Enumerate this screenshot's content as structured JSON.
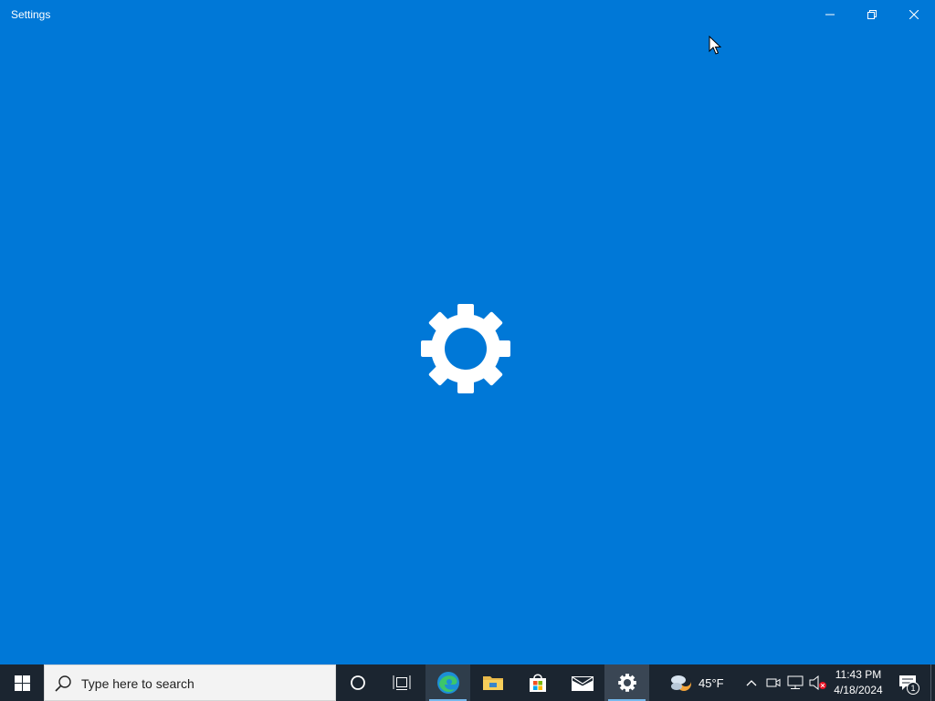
{
  "window": {
    "title": "Settings",
    "background_color": "#0078d7",
    "controls": {
      "minimize_icon": "minimize-icon",
      "maximize_icon": "restore-icon",
      "close_icon": "close-icon"
    },
    "splash_icon": "gear-icon"
  },
  "taskbar": {
    "start_icon": "windows-logo-icon",
    "search": {
      "placeholder": "Type here to search",
      "icon": "search-icon"
    },
    "cortana_icon": "cortana-icon",
    "task_view_icon": "task-view-icon",
    "pinned_apps": [
      {
        "name": "Microsoft Edge",
        "icon": "edge-icon",
        "running": true
      },
      {
        "name": "File Explorer",
        "icon": "folder-icon",
        "running": false
      },
      {
        "name": "Microsoft Store",
        "icon": "store-icon",
        "running": false
      },
      {
        "name": "Mail",
        "icon": "mail-icon",
        "running": false
      },
      {
        "name": "Settings",
        "icon": "gear-icon",
        "running": true,
        "active": true
      }
    ],
    "weather": {
      "temperature": "45°F",
      "icon": "partly-cloudy-night-icon"
    },
    "tray": {
      "chevron_icon": "chevron-up-icon",
      "meet_icon": "meet-now-icon",
      "network_icon": "network-icon",
      "volume_icon": "volume-muted-icon"
    },
    "clock": {
      "time": "11:43 PM",
      "date": "4/18/2024"
    },
    "notifications": {
      "count": "1",
      "icon": "action-center-icon"
    },
    "accent_color": "#76b9ed"
  }
}
